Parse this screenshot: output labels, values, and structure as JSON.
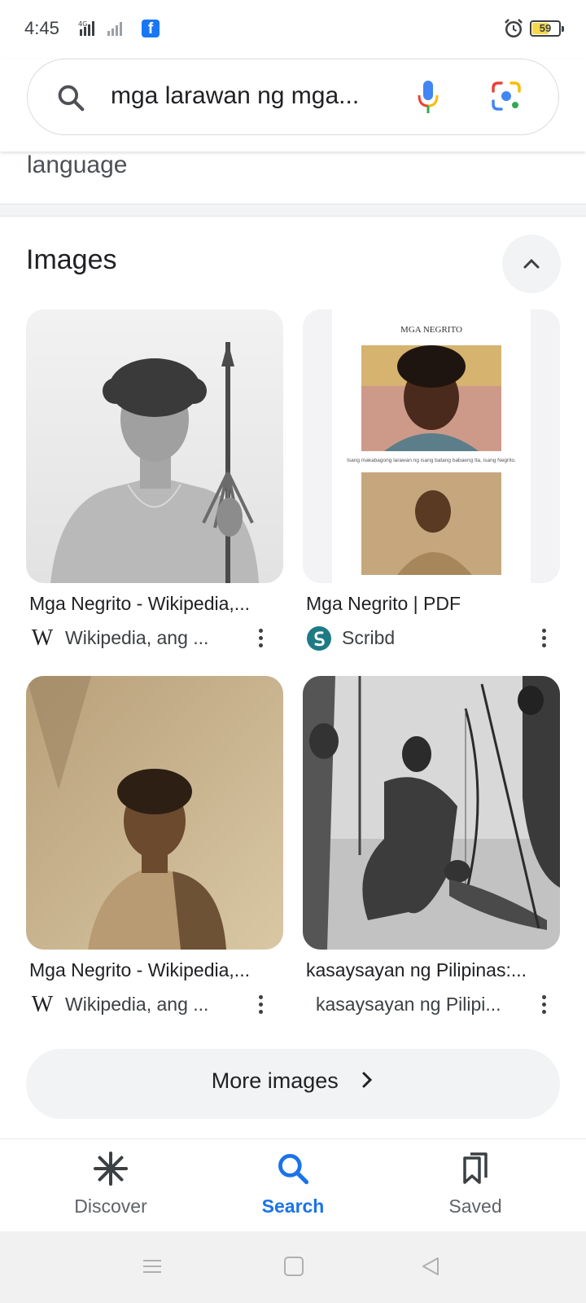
{
  "status_bar": {
    "time": "4:45",
    "network": "4G",
    "battery": "59",
    "battery_percent": 59
  },
  "search": {
    "query": "mga larawan ng mga...",
    "icons": [
      "search-icon",
      "mic-icon",
      "google-lens-icon"
    ]
  },
  "previous_section": {
    "text": "language"
  },
  "images_section": {
    "title": "Images",
    "results": [
      {
        "title": "Mga Negrito - Wikipedia,...",
        "source": "Wikipedia, ang ...",
        "source_icon": "wikipedia-icon"
      },
      {
        "title": "Mga Negrito | PDF",
        "source": "Scribd",
        "source_icon": "scribd-icon",
        "thumb_heading": "MGA NEGRITO",
        "thumb_caption": "Isang makabagong larawan ng isang batang babaeng Ita, isang Negrito."
      },
      {
        "title": "Mga Negrito - Wikipedia,...",
        "source": "Wikipedia, ang ...",
        "source_icon": "wikipedia-icon"
      },
      {
        "title": "kasaysayan ng Pilipinas:...",
        "source": "kasaysayan ng Pilipi...",
        "source_icon": "none"
      }
    ],
    "more_button": "More images"
  },
  "bottom_nav": {
    "items": [
      {
        "label": "Discover",
        "icon": "asterisk-icon"
      },
      {
        "label": "Search",
        "icon": "search-icon",
        "active": true
      },
      {
        "label": "Saved",
        "icon": "bookmarks-icon"
      }
    ]
  },
  "colors": {
    "accent": "#1a73e8",
    "text": "#202124",
    "secondary_text": "#5f6368",
    "chip_background": "#f1f3f4"
  }
}
